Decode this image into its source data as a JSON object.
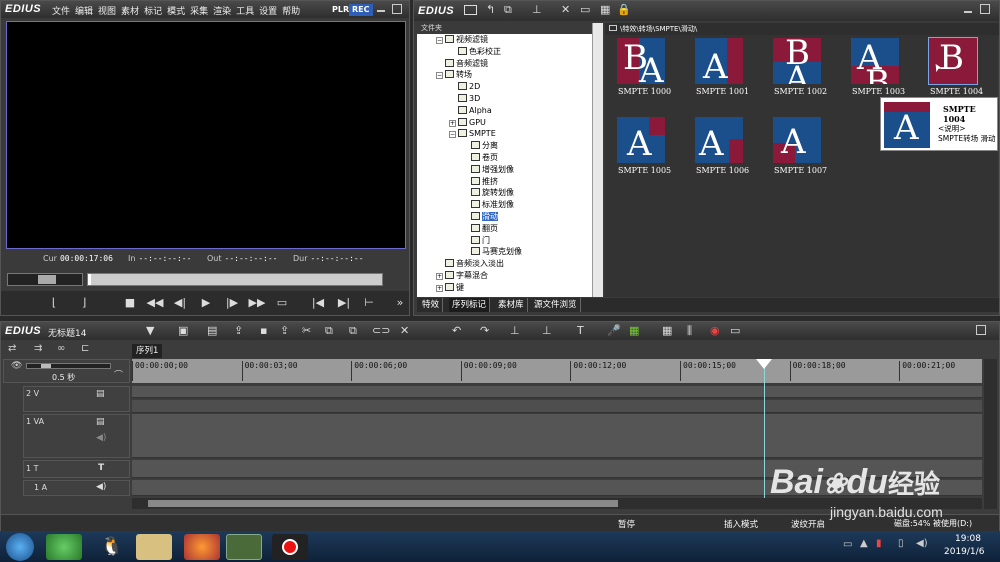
{
  "player": {
    "brand": "EDIUS",
    "menu": [
      "文件",
      "编辑",
      "视图",
      "素材",
      "标记",
      "模式",
      "采集",
      "渲染",
      "工具",
      "设置",
      "帮助"
    ],
    "plr": "PLR",
    "rec": "REC",
    "cur_label": "Cur",
    "cur_value": "00:00:17:06",
    "in_label": "In",
    "in_value": "--:--:--:--",
    "out_label": "Out",
    "out_value": "--:--:--:--",
    "dur_label": "Dur",
    "dur_value": "--:--:--:--"
  },
  "library": {
    "brand": "EDIUS",
    "folder_label": "文件夹",
    "path": "\\特效\\转场\\SMPTE\\滑动\\",
    "tree": [
      {
        "label": "视频滤镜",
        "level": 1,
        "exp": "−"
      },
      {
        "label": "色彩校正",
        "level": 2,
        "exp": ""
      },
      {
        "label": "音频滤镜",
        "level": 1,
        "exp": ""
      },
      {
        "label": "转场",
        "level": 1,
        "exp": "−"
      },
      {
        "label": "2D",
        "level": 2,
        "exp": ""
      },
      {
        "label": "3D",
        "level": 2,
        "exp": ""
      },
      {
        "label": "Alpha",
        "level": 2,
        "exp": ""
      },
      {
        "label": "GPU",
        "level": 2,
        "exp": "+"
      },
      {
        "label": "SMPTE",
        "level": 2,
        "exp": "−"
      },
      {
        "label": "分离",
        "level": 3,
        "exp": ""
      },
      {
        "label": "卷页",
        "level": 3,
        "exp": ""
      },
      {
        "label": "增强划像",
        "level": 3,
        "exp": ""
      },
      {
        "label": "推挤",
        "level": 3,
        "exp": ""
      },
      {
        "label": "旋转划像",
        "level": 3,
        "exp": ""
      },
      {
        "label": "标准划像",
        "level": 3,
        "exp": ""
      },
      {
        "label": "滑动",
        "level": 3,
        "exp": "",
        "selected": true
      },
      {
        "label": "翻页",
        "level": 3,
        "exp": ""
      },
      {
        "label": "门",
        "level": 3,
        "exp": ""
      },
      {
        "label": "马赛克划像",
        "level": 3,
        "exp": ""
      },
      {
        "label": "音频淡入淡出",
        "level": 1,
        "exp": ""
      },
      {
        "label": "字幕混合",
        "level": 1,
        "exp": "+"
      },
      {
        "label": "键",
        "level": 1,
        "exp": "+"
      }
    ],
    "thumbs": [
      {
        "name": "SMPTE 1000"
      },
      {
        "name": "SMPTE 1001"
      },
      {
        "name": "SMPTE 1002"
      },
      {
        "name": "SMPTE 1003"
      },
      {
        "name": "SMPTE 1004"
      },
      {
        "name": "SMPTE 1005"
      },
      {
        "name": "SMPTE 1006"
      },
      {
        "name": "SMPTE 1007"
      }
    ],
    "tooltip": {
      "title": "SMPTE 1004",
      "line1": "<说明>",
      "line2": "SMPTE转场 滑动"
    },
    "tabs": [
      "特效",
      "序列标记",
      "素材库",
      "源文件浏览"
    ]
  },
  "timeline": {
    "brand": "EDIUS",
    "project": "无标题14",
    "sequence_tab": "序列1",
    "zoom": "0.5 秒",
    "ruler": [
      "00:00:00;00",
      "00:00:03;00",
      "00:00:06;00",
      "00:00:09;00",
      "00:00:12;00",
      "00:00:15;00",
      "00:00:18;00",
      "00:00:21;00"
    ],
    "tracks": [
      "2 V",
      "1 VA",
      "1 T",
      "1 A"
    ],
    "status": {
      "pause": "暂停",
      "insert": "插入模式",
      "ripple": "波纹开启",
      "disk": "磁盘:54% 被使用(D:)"
    }
  },
  "taskbar": {
    "time": "19:08",
    "date": "2019/1/6"
  },
  "watermark": {
    "brand": "Bai",
    "brand2": "du",
    "cn": "经验",
    "url": "jingyan.baidu.com"
  }
}
